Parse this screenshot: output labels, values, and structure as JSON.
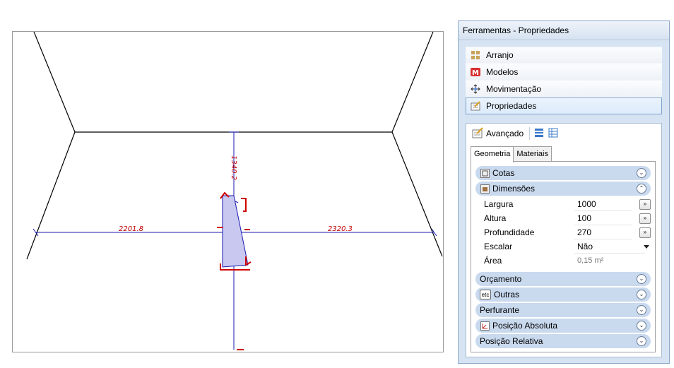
{
  "viewport": {
    "dimension_left": "2201.8",
    "dimension_right": "2320.3",
    "dimension_top": "1340.2",
    "line_color": "#1a1ab0",
    "mark_color": "#d00000",
    "shape_fill": "#c8c8f0"
  },
  "panel": {
    "title": "Ferramentas - Propriedades",
    "nav": [
      {
        "label": "Arranjo",
        "icon": "arrangement-icon"
      },
      {
        "label": "Modelos",
        "icon": "models-icon"
      },
      {
        "label": "Movimentação",
        "icon": "move-icon"
      },
      {
        "label": "Propriedades",
        "icon": "properties-icon",
        "selected": true
      }
    ],
    "toolbar": {
      "label": "Avançado"
    },
    "tabs": [
      "Geometria",
      "Materiais"
    ],
    "groups": {
      "cotas": "Cotas",
      "dimensoes": "Dimensões",
      "orcamento": "Orçamento",
      "outras": "Outras",
      "perfurante": "Perfurante",
      "posicao_absoluta": "Posição Absoluta",
      "posicao_relativa": "Posição Relativa"
    },
    "props": {
      "largura": {
        "label": "Largura",
        "value": "1000"
      },
      "altura": {
        "label": "Altura",
        "value": "100"
      },
      "profundidade": {
        "label": "Profundidade",
        "value": "270"
      },
      "escalar": {
        "label": "Escalar",
        "value": "Não"
      },
      "area": {
        "label": "Área",
        "value": "0,15 m²"
      }
    },
    "icon_text_etc": "etc",
    "button_glyph": "»",
    "expand_glyph": "⌄",
    "collapse_glyph": "⌃"
  }
}
